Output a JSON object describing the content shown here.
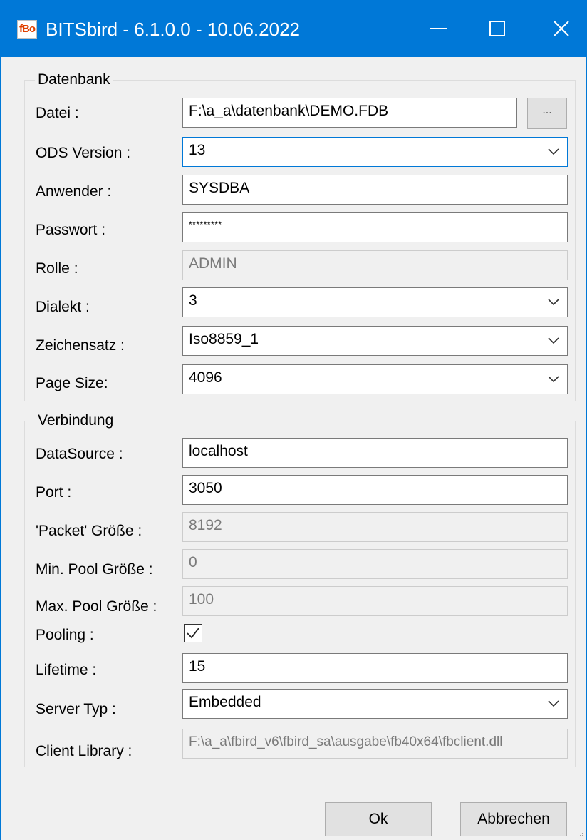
{
  "window": {
    "title": "BITSbird - 6.1.0.0 - 10.06.2022",
    "icon_text": "fBo",
    "controls": [
      "minimize-icon",
      "maximize-icon",
      "close-icon"
    ],
    "accent_color": "#0078d7"
  },
  "datenbank": {
    "group_title": "Datenbank",
    "datei": {
      "label": "Datei :",
      "value": "F:\\a_a\\datenbank\\DEMO.FDB",
      "browse_label": "..."
    },
    "ods_version": {
      "label": "ODS Version :",
      "value": "13"
    },
    "anwender": {
      "label": "Anwender :",
      "value": "SYSDBA"
    },
    "passwort": {
      "label": "Passwort :",
      "value": "*********"
    },
    "rolle": {
      "label": "Rolle :",
      "value": "ADMIN"
    },
    "dialekt": {
      "label": "Dialekt :",
      "value": "3"
    },
    "zeichensatz": {
      "label": "Zeichensatz :",
      "value": "Iso8859_1"
    },
    "page_size": {
      "label": "Page Size:",
      "value": "4096"
    }
  },
  "verbindung": {
    "group_title": "Verbindung",
    "datasource": {
      "label": "DataSource :",
      "value": "localhost"
    },
    "port": {
      "label": "Port :",
      "value": "3050"
    },
    "packet_groesse": {
      "label": "'Packet' Größe :",
      "value": "8192"
    },
    "min_pool": {
      "label": "Min. Pool Größe :",
      "value": "0"
    },
    "max_pool": {
      "label": "Max. Pool Größe :",
      "value": "100"
    },
    "pooling": {
      "label": "Pooling :",
      "checked": true
    },
    "lifetime": {
      "label": "Lifetime :",
      "value": "15"
    },
    "server_typ": {
      "label": "Server Typ :",
      "value": "Embedded"
    },
    "client_library": {
      "label": "Client Library :",
      "value": "F:\\a_a\\fbird_v6\\fbird_sa\\ausgabe\\fb40x64\\fbclient.dll"
    }
  },
  "buttons": {
    "ok": "Ok",
    "cancel": "Abbrechen"
  }
}
